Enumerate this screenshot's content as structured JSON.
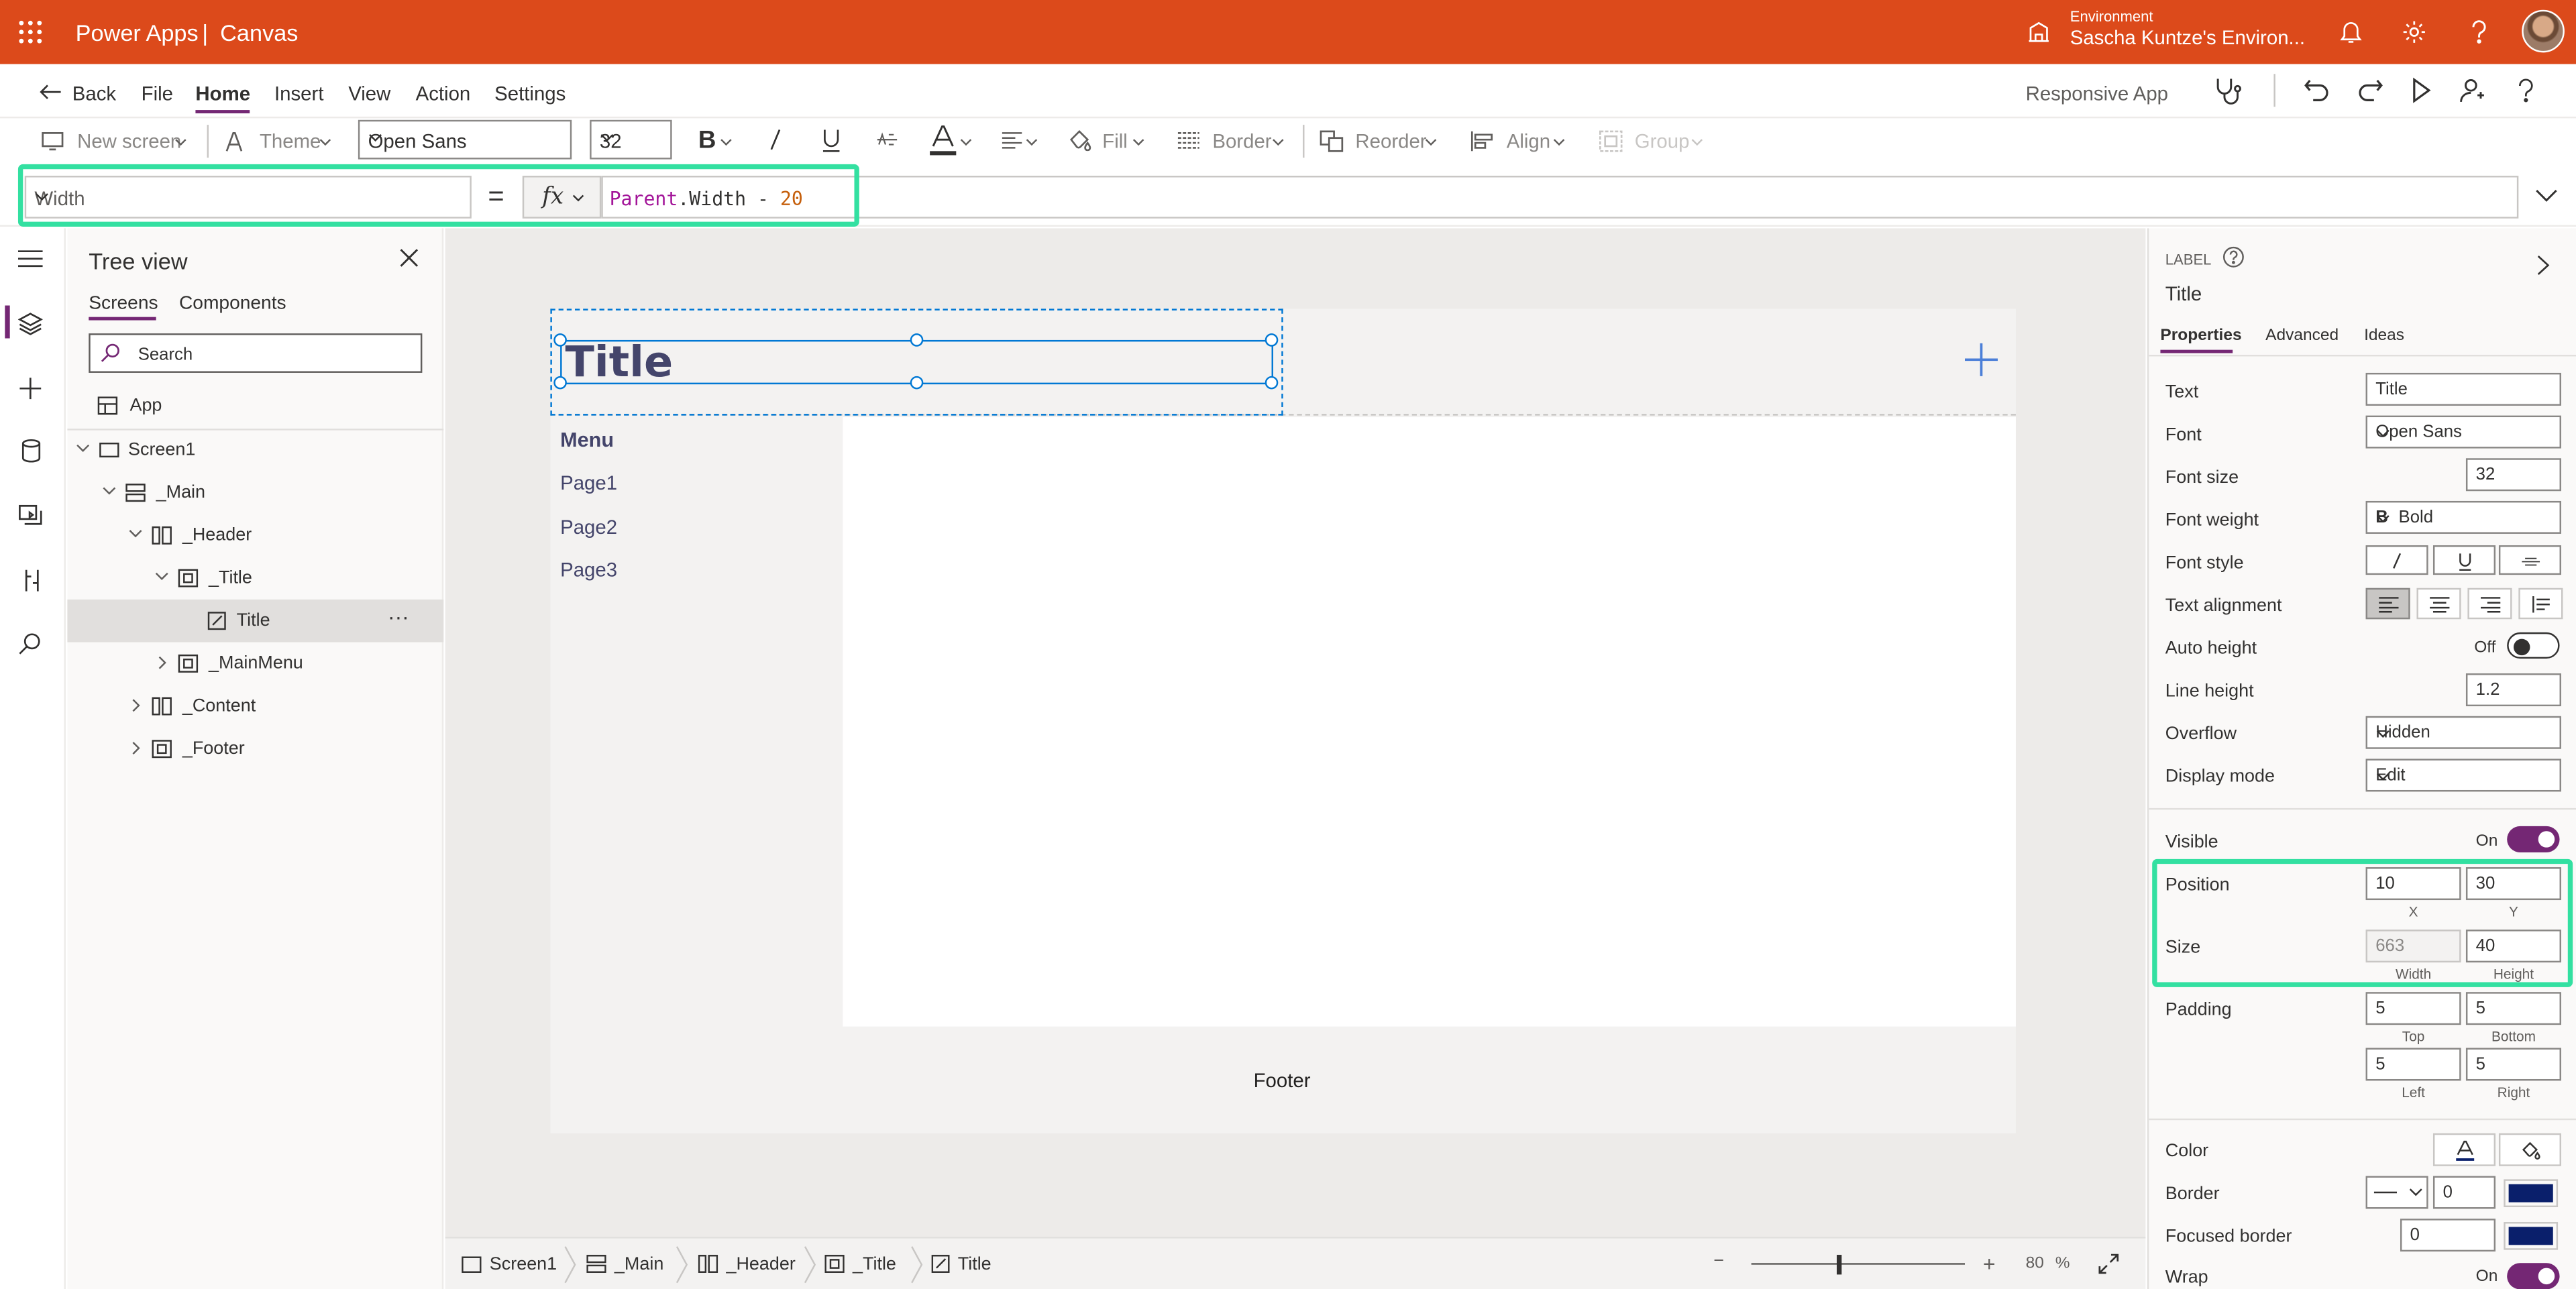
{
  "topbar": {
    "app_name": "Power Apps",
    "separator": "|",
    "context": "Canvas",
    "env_label": "Environment",
    "env_name": "Sascha Kuntze's Environ...",
    "bg_color": "#dc4a1b"
  },
  "menubar": {
    "back": "Back",
    "items": [
      "File",
      "Home",
      "Insert",
      "View",
      "Action",
      "Settings"
    ],
    "active": "Home",
    "app_type": "Responsive App"
  },
  "toolbar": {
    "new_screen": "New screen",
    "theme": "Theme",
    "font": "Open Sans",
    "font_size": "32",
    "fill": "Fill",
    "border": "Border",
    "reorder": "Reorder",
    "align": "Align",
    "group": "Group"
  },
  "formula": {
    "property": "Width",
    "equals": "=",
    "fx": "fx",
    "token_parent": "Parent",
    "token_dot": ".Width",
    "token_op": " - ",
    "token_num": "20"
  },
  "tree": {
    "title": "Tree view",
    "tabs": [
      "Screens",
      "Components"
    ],
    "active_tab": "Screens",
    "search_placeholder": "Search",
    "app": "App",
    "nodes": [
      "Screen1",
      "_Main",
      "_Header",
      "_Title",
      "Title",
      "_MainMenu",
      "_Content",
      "_Footer"
    ],
    "selected": "Title",
    "more": "···"
  },
  "canvas": {
    "title": "Title",
    "menu_header": "Menu",
    "menu_items": [
      "Page1",
      "Page2",
      "Page3"
    ],
    "footer": "Footer",
    "add_symbol": "+"
  },
  "bottombar": {
    "crumbs": [
      "Screen1",
      "_Main",
      "_Header",
      "_Title",
      "Title"
    ],
    "zoom_minus": "−",
    "zoom_plus": "+",
    "zoom_value": "80",
    "zoom_unit": "%",
    "zoom_fraction": 0.4
  },
  "props": {
    "type": "LABEL",
    "name": "Title",
    "tabs": [
      "Properties",
      "Advanced",
      "Ideas"
    ],
    "active_tab": "Properties",
    "text_label": "Text",
    "text_value": "Title",
    "font_label": "Font",
    "font_value": "Open Sans",
    "font_size_label": "Font size",
    "font_size_value": "32",
    "font_weight_label": "Font weight",
    "font_weight_icon": "B",
    "font_weight_value": "Bold",
    "font_style_label": "Font style",
    "text_align_label": "Text alignment",
    "auto_height_label": "Auto height",
    "auto_height_state": "Off",
    "line_height_label": "Line height",
    "line_height_value": "1.2",
    "overflow_label": "Overflow",
    "overflow_value": "Hidden",
    "display_mode_label": "Display mode",
    "display_mode_value": "Edit",
    "visible_label": "Visible",
    "visible_state": "On",
    "position_label": "Position",
    "x_value": "10",
    "y_value": "30",
    "x_sub": "X",
    "y_sub": "Y",
    "size_label": "Size",
    "width_value": "663",
    "height_value": "40",
    "width_sub": "Width",
    "height_sub": "Height",
    "padding_label": "Padding",
    "pad_top": "5",
    "pad_bottom": "5",
    "pad_left": "5",
    "pad_right": "5",
    "pad_top_sub": "Top",
    "pad_bottom_sub": "Bottom",
    "pad_left_sub": "Left",
    "pad_right_sub": "Right",
    "color_label": "Color",
    "border_label": "Border",
    "border_value": "0",
    "focused_border_label": "Focused border",
    "focused_border_value": "0",
    "wrap_label": "Wrap",
    "wrap_state": "On",
    "swatch_color": "#0a1f6b",
    "accent": "#742774",
    "highlight": "#33e0a1"
  }
}
